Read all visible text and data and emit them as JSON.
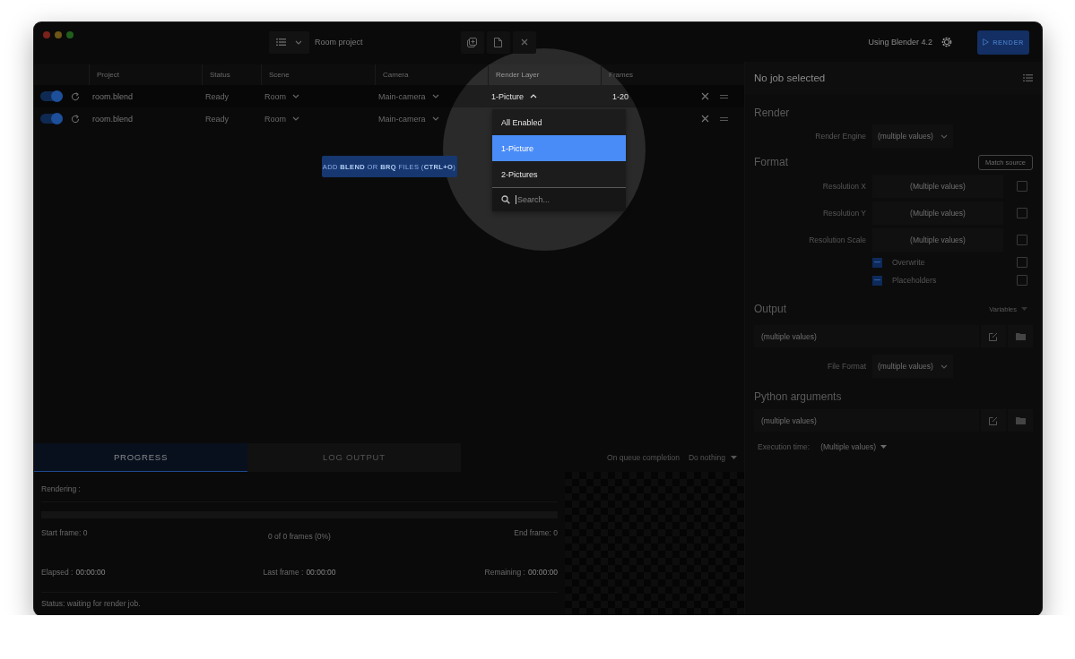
{
  "window": {
    "traffic_lights": [
      {
        "color": "#7a211c"
      },
      {
        "color": "#6e5616"
      },
      {
        "color": "#1f5f1b"
      }
    ]
  },
  "toolbar": {
    "project_name": "Room project",
    "blender_version": "Using Blender 4.2",
    "render_button": "RENDER"
  },
  "table": {
    "columns": [
      "Project",
      "Status",
      "Scene",
      "Camera",
      "Render Layer",
      "Frames"
    ],
    "rows": [
      {
        "enabled": true,
        "project": "room.blend",
        "status": "Ready",
        "scene": "Room",
        "camera": "Main-camera",
        "render_layer": "1-Picture",
        "layer_open": true,
        "frames": "1-20",
        "highlighted": true
      },
      {
        "enabled": true,
        "project": "room.blend",
        "status": "Ready",
        "scene": "Room",
        "camera": "Main-camera",
        "highlighted": false
      }
    ]
  },
  "add_button": "ADD **BLEND** OR **BRQ** FILES (**CTRL+O**)",
  "dropdown": {
    "options": [
      {
        "label": "All Enabled",
        "selected": false
      },
      {
        "label": "1-Picture",
        "selected": true
      },
      {
        "label": "2-Pictures",
        "selected": false
      }
    ],
    "search_placeholder": "Search..."
  },
  "bottom_tabs": [
    {
      "label": "PROGRESS",
      "selected": true
    },
    {
      "label": "LOG OUTPUT",
      "selected": false
    }
  ],
  "queue_completion": {
    "label": "On queue completion",
    "value": "Do nothing"
  },
  "progress": {
    "rendering": "Rendering :",
    "level": 0,
    "start_frame": "Start frame: 0",
    "frames_count": "0 of 0 frames (0%)",
    "end_frame": "End frame: 0",
    "elapsed_label": "Elapsed :",
    "elapsed": "00:00:00",
    "last_frame_label": "Last frame :",
    "last_frame": "00:00:00",
    "remaining_label": "Remaining :",
    "remaining": "00:00:00",
    "status": "Status: waiting for render job."
  },
  "job_panel": {
    "title": "No job selected",
    "render": {
      "heading": "Render",
      "engine_label": "Render Engine",
      "engine_value": "(multiple values)"
    },
    "format": {
      "heading": "Format",
      "match_button": "Match source",
      "fields": [
        {
          "label": "Resolution X",
          "value": "(Multiple values)",
          "checked": false
        },
        {
          "label": "Resolution Y",
          "value": "(Multiple values)",
          "checked": false
        },
        {
          "label": "Resolution Scale",
          "value": "(Multiple values)",
          "checked": false
        }
      ],
      "options": [
        {
          "label": "Overwrite",
          "mixed": true,
          "checked": false
        },
        {
          "label": "Placeholders",
          "mixed": true,
          "checked": false
        }
      ]
    },
    "output": {
      "heading": "Output",
      "variables": "Variables",
      "path_placeholder": "(multiple values)",
      "format_label": "File Format",
      "format_value": "(multiple values)"
    },
    "python": {
      "heading": "Python arguments",
      "args_placeholder": "(multiple values)"
    },
    "execution_label": "Execution time:",
    "execution_value": "(Multiple values)"
  }
}
